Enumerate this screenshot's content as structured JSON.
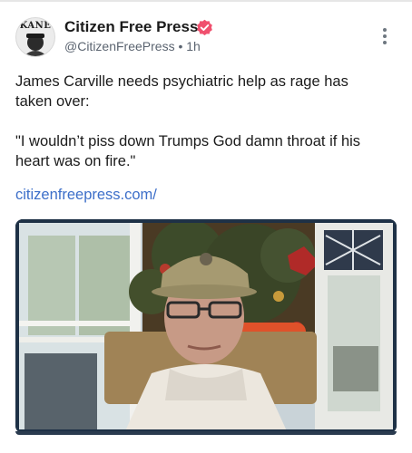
{
  "post": {
    "author_name": "Citizen Free Press",
    "handle": "@CitizenFreePress",
    "separator": "•",
    "time": "1h",
    "avatar_text": "KANE",
    "paragraph_1": "James Carville needs psychiatric help as rage has taken over:",
    "paragraph_2": "\"I wouldn’t piss down Trumps God damn throat if his heart was on fire.\"",
    "link_text": "citizenfreepress.com/",
    "media_type": "video",
    "video_progress": 0
  },
  "icons": {
    "verified": "verified-badge-icon",
    "more": "more-vertical-icon"
  },
  "colors": {
    "verified_badge": "#f0506e",
    "link": "#3d6fc9",
    "handle": "#5b6470",
    "media_frame": "#1e3146"
  }
}
